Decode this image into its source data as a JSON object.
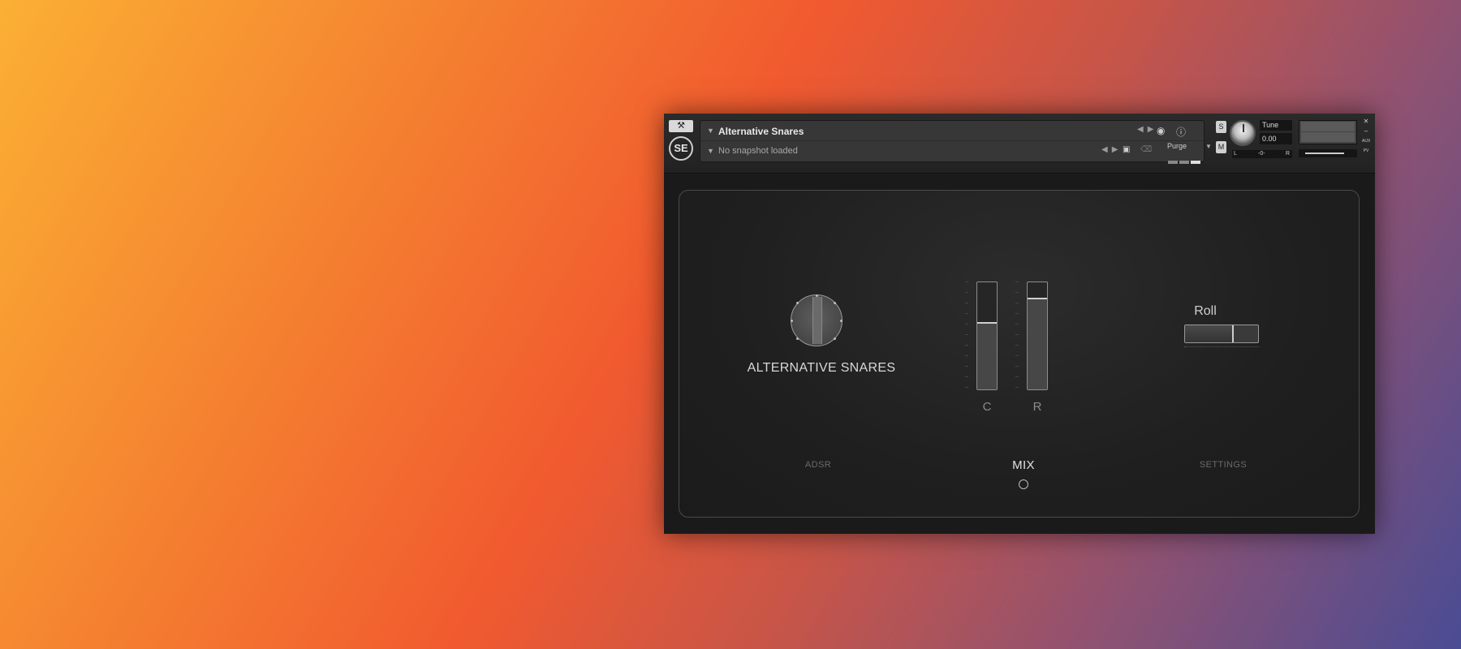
{
  "header": {
    "instrument_name": "Alternative Snares",
    "snapshot_status": "No snapshot loaded",
    "logo_text": "SE",
    "purge_label": "Purge",
    "tune_label": "Tune",
    "tune_value": "0.00",
    "pan_left": "L",
    "pan_center": "-0-",
    "pan_right": "R",
    "side_btn_s": "S",
    "side_btn_m": "M",
    "aux_label": "AUX",
    "pv_label": "PV"
  },
  "main": {
    "title": "ALTERNATIVE SNARES",
    "fader_c": {
      "label": "C",
      "level": 0.62
    },
    "fader_r": {
      "label": "R",
      "level": 0.85
    },
    "roll_label": "Roll",
    "roll_state": "off"
  },
  "tabs": [
    {
      "label": "ADSR",
      "active": false
    },
    {
      "label": "MIX",
      "active": true
    },
    {
      "label": "SETTINGS",
      "active": false
    }
  ],
  "colors": {
    "panel_bg": "#1a1a1a",
    "accent_light": "#d8d8d8",
    "tab_inactive": "#6a6a6a"
  }
}
